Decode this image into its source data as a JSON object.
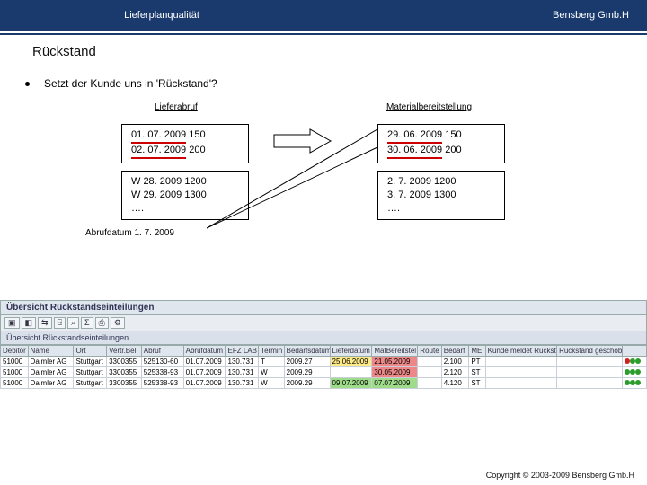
{
  "header": {
    "left": "Lieferplanqualität",
    "right": "Bensberg Gmb.H"
  },
  "title": "Rückstand",
  "bullet": "Setzt der Kunde uns in 'Rückstand'?",
  "diagram": {
    "left_heading": "Lieferabruf",
    "right_heading": "Materialbereitstellung",
    "left_box1": {
      "l1_a": "01. 07. 2009",
      "l1_b": "150",
      "l2_a": "02. 07. 2009",
      "l2_b": "200"
    },
    "left_box2": {
      "l1": "W 28. 2009 1200",
      "l2": "W 29. 2009 1300",
      "l3": "…."
    },
    "right_box1": {
      "l1_a": "29. 06. 2009",
      "l1_b": "150",
      "l2_a": "30. 06. 2009",
      "l2_b": "200"
    },
    "right_box2": {
      "l1": "2. 7. 2009 1200",
      "l2": "3. 7. 2009 1300",
      "l3": "…."
    },
    "abrufdatum": "Abrufdatum  1. 7. 2009"
  },
  "sap": {
    "title": "Übersicht Rückstandseinteilungen",
    "strip": "Übersicht Rückstandseinteilungen",
    "columns": [
      "Debitor",
      "Name",
      "Ort",
      "Vertr.Bel.",
      "Abruf",
      "Abrufdatum",
      "EFZ LAB",
      "Termin",
      "Bedarfsdatum",
      "Lieferdatum",
      "MatBereitstel",
      "Route",
      "Bedarf",
      "ME",
      "Kunde meldet Rückstand",
      "Rückstand geschoben",
      ""
    ],
    "rows": [
      {
        "c": [
          "51000",
          "Daimler AG",
          "Stuttgart",
          "3300355",
          "525130-60",
          "01.07.2009",
          "130.731",
          "T",
          "2009.27",
          "25.06.2009",
          "21.05.2009",
          "",
          "2.100",
          "PT",
          "",
          ""
        ],
        "ind": [
          "r",
          "g",
          "g"
        ],
        "yellow_cols": [
          9
        ],
        "red_cols": [
          10
        ]
      },
      {
        "c": [
          "51000",
          "Daimler AG",
          "Stuttgart",
          "3300355",
          "525338-93",
          "01.07.2009",
          "130.731",
          "W",
          "2009.29",
          "",
          "30.05.2009",
          "",
          "2.120",
          "ST",
          "",
          ""
        ],
        "ind": [
          "g",
          "g",
          "g"
        ],
        "yellow_cols": [],
        "red_cols": [
          10
        ]
      },
      {
        "c": [
          "51000",
          "Daimler AG",
          "Stuttgart",
          "3300355",
          "525338-93",
          "01.07.2009",
          "130.731",
          "W",
          "2009.29",
          "09.07.2009",
          "07.07.2009",
          "",
          "4.120",
          "ST",
          "",
          ""
        ],
        "ind": [
          "g",
          "g",
          "g"
        ],
        "yellow_cols": [],
        "red_cols": [],
        "green_cols": [
          9,
          10
        ]
      }
    ]
  },
  "copyright": "Copyright © 2003-2009 Bensberg Gmb.H"
}
